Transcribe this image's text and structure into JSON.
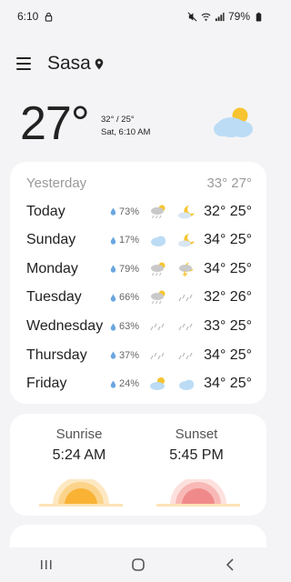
{
  "status_bar": {
    "time": "6:10",
    "battery": "79%"
  },
  "header": {
    "location": "Sasa"
  },
  "current": {
    "temperature": "27°",
    "high_low": "32° / 25°",
    "datetime": "Sat, 6:10 AM"
  },
  "forecast": [
    {
      "day": "Yesterday",
      "precip": "",
      "icon1": "",
      "icon2": "",
      "temps": "33° 27°",
      "muted": true
    },
    {
      "day": "Today",
      "precip": "73%",
      "icon1": "sun-rain-icon",
      "icon2": "moon-cloud-icon",
      "temps": "32° 25°"
    },
    {
      "day": "Sunday",
      "precip": "17%",
      "icon1": "cloud-icon",
      "icon2": "moon-cloud-icon",
      "temps": "34° 25°"
    },
    {
      "day": "Monday",
      "precip": "79%",
      "icon1": "sun-rain-icon",
      "icon2": "thunder-moon-icon",
      "temps": "34° 25°"
    },
    {
      "day": "Tuesday",
      "precip": "66%",
      "icon1": "sun-rain-icon",
      "icon2": "rain-icon",
      "temps": "32° 26°"
    },
    {
      "day": "Wednesday",
      "precip": "63%",
      "icon1": "rain-icon",
      "icon2": "rain-icon",
      "temps": "33° 25°"
    },
    {
      "day": "Thursday",
      "precip": "37%",
      "icon1": "rain-icon",
      "icon2": "rain-icon",
      "temps": "34° 25°"
    },
    {
      "day": "Friday",
      "precip": "24%",
      "icon1": "sun-cloud-icon",
      "icon2": "cloud-icon",
      "temps": "34° 25°"
    }
  ],
  "sun": {
    "sunrise_label": "Sunrise",
    "sunrise_time": "5:24 AM",
    "sunset_label": "Sunset",
    "sunset_time": "5:45 PM"
  },
  "colors": {
    "background": "#f4f4f6",
    "card": "#ffffff",
    "sunrise": "#f9b233",
    "sunset": "#f08a8a",
    "drop": "#6aa6e0",
    "cloud": "#bcdcf5"
  }
}
